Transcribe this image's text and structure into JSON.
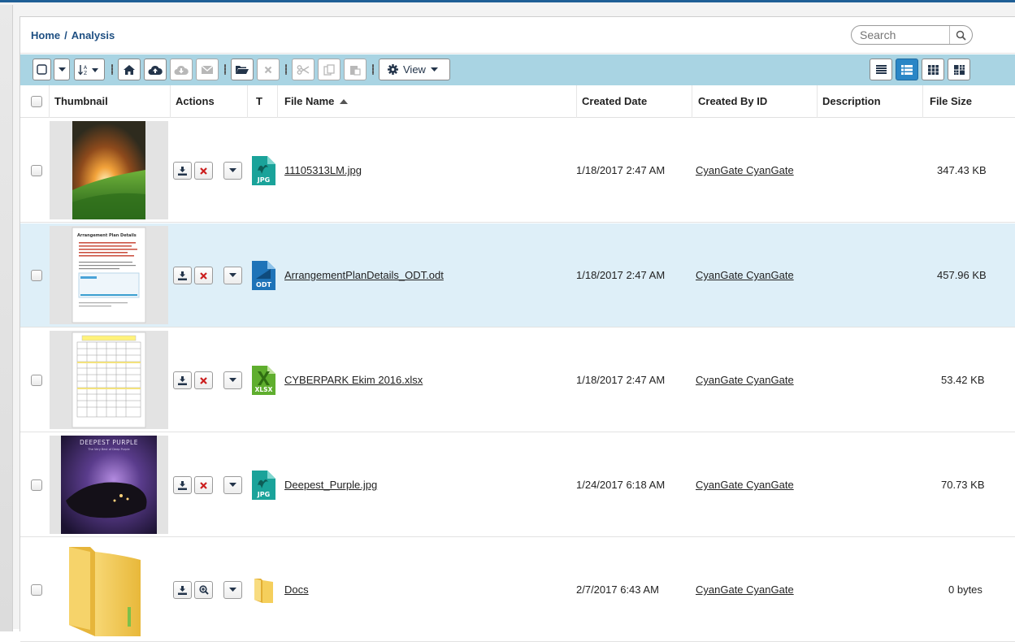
{
  "breadcrumb": {
    "home": "Home",
    "separator": "/",
    "current": "Analysis"
  },
  "search": {
    "placeholder": "Search"
  },
  "toolbar": {
    "view_label": "View"
  },
  "columns": {
    "thumbnail": "Thumbnail",
    "actions": "Actions",
    "type": "T",
    "file_name": "File Name",
    "created_date": "Created Date",
    "created_by": "Created By ID",
    "description": "Description",
    "file_size": "File Size"
  },
  "rows": [
    {
      "file_name": "11105313LM.jpg",
      "type_badge": "JPG",
      "type_color": "#1aa39a",
      "created_date": "1/18/2017 2:47 AM",
      "created_by": "CyanGate CyanGate",
      "description": "",
      "file_size": "347.43 KB"
    },
    {
      "file_name": "ArrangementPlanDetails_ODT.odt",
      "type_badge": "ODT",
      "type_color": "#1e73b8",
      "created_date": "1/18/2017 2:47 AM",
      "created_by": "CyanGate CyanGate",
      "description": "",
      "file_size": "457.96 KB"
    },
    {
      "file_name": "CYBERPARK Ekim 2016.xlsx",
      "type_badge": "XLSX",
      "type_color": "#5fae2e",
      "created_date": "1/18/2017 2:47 AM",
      "created_by": "CyanGate CyanGate",
      "description": "",
      "file_size": "53.42 KB"
    },
    {
      "file_name": "Deepest_Purple.jpg",
      "type_badge": "JPG",
      "type_color": "#1aa39a",
      "created_date": "1/24/2017 6:18 AM",
      "created_by": "CyanGate CyanGate",
      "description": "",
      "file_size": "70.73 KB"
    },
    {
      "file_name": "Docs",
      "type_badge": "",
      "type_color": "#e8c34a",
      "created_date": "2/7/2017 6:43 AM",
      "created_by": "CyanGate CyanGate",
      "description": "",
      "file_size": "0 bytes"
    }
  ],
  "thumb_texts": {
    "doc_title": "Arrangement Plan Details",
    "album_title": "DEEPEST PURPLE",
    "album_subtitle": "The Very Best of Deep Purple"
  },
  "colors": {
    "accent": "#2a86c6",
    "toolbar_bg": "#a9d4e3",
    "highlight_row": "#deeff8",
    "delete_red": "#cc1f1f"
  }
}
